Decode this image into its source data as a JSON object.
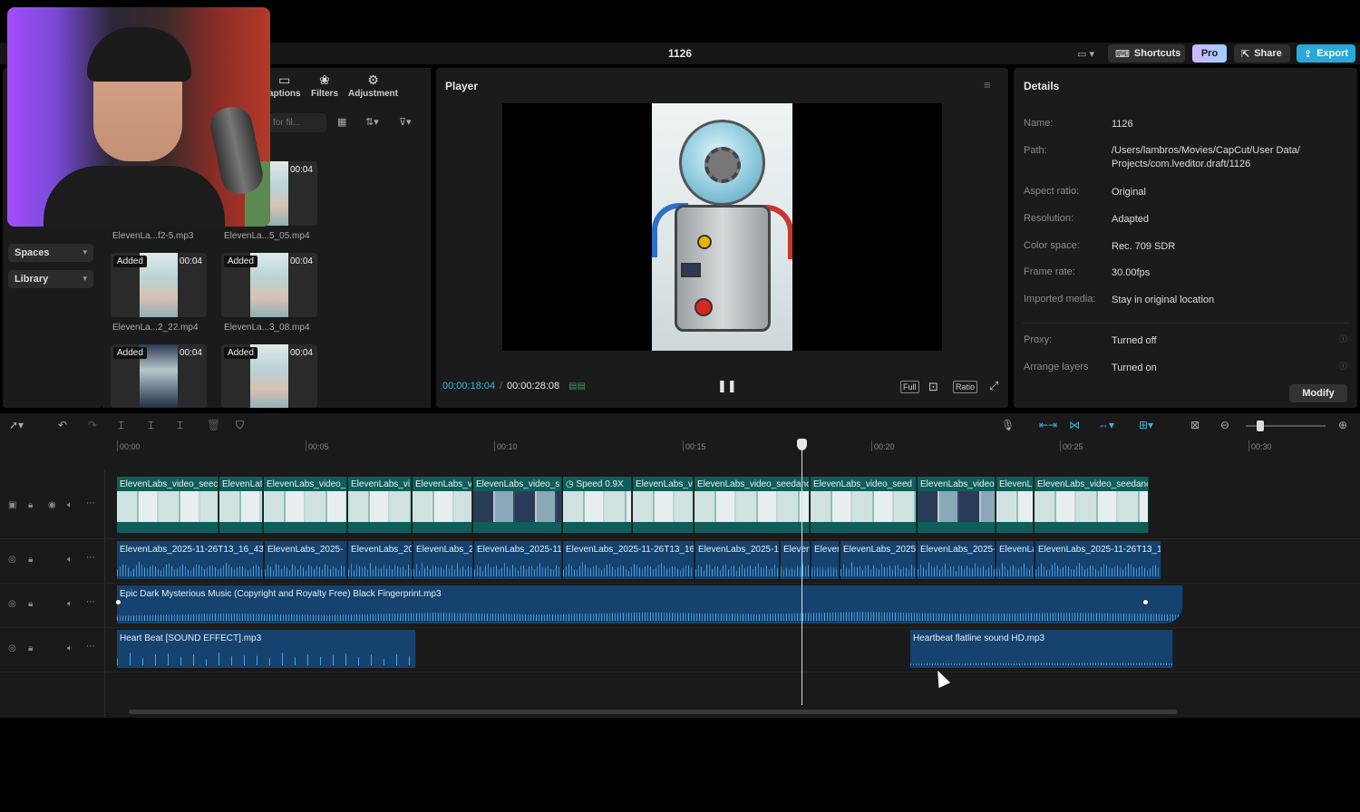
{
  "app": {
    "project_title": "1126",
    "shortcuts_label": "Shortcuts",
    "pro_label": "Pro",
    "share_label": "Share",
    "export_label": "Export"
  },
  "media_panel": {
    "tabs": [
      {
        "label": "aptions",
        "icon": "captions-icon"
      },
      {
        "label": "Filters",
        "icon": "filters-icon"
      },
      {
        "label": "Adjustment",
        "icon": "adjustment-icon"
      }
    ],
    "search_placeholder": "for fil...",
    "nav": {
      "spaces_label": "Spaces",
      "library_label": "Library"
    },
    "items": [
      {
        "name": "ElevenLa...f2-5.mp3",
        "badge": "",
        "duration": ""
      },
      {
        "name": "ElevenLa...5_05.mp4",
        "badge": "",
        "duration": "00:04"
      },
      {
        "name": "ElevenLa...2_22.mp4",
        "badge": "Added",
        "duration": "00:04"
      },
      {
        "name": "ElevenLa...3_08.mp4",
        "badge": "Added",
        "duration": "00:04"
      },
      {
        "name": "",
        "badge": "Added",
        "duration": "00:04"
      },
      {
        "name": "",
        "badge": "Added",
        "duration": "00:04"
      }
    ]
  },
  "player": {
    "title": "Player",
    "current_time": "00:00:18:04",
    "separator": "/",
    "total_time": "00:00:28:08",
    "full_label": "Full",
    "ratio_label": "Ratio"
  },
  "details": {
    "title": "Details",
    "fields": [
      {
        "label": "Name:",
        "value": "1126"
      },
      {
        "label": "Path:",
        "value": "/Users/lambros/Movies/CapCut/User Data/\nProjects/com.lveditor.draft/1126"
      },
      {
        "label": "Aspect ratio:",
        "value": "Original"
      },
      {
        "label": "Resolution:",
        "value": "Adapted"
      },
      {
        "label": "Color space:",
        "value": "Rec. 709 SDR"
      },
      {
        "label": "Frame rate:",
        "value": "30.00fps"
      },
      {
        "label": "Imported media:",
        "value": "Stay in original location"
      },
      {
        "label": "Proxy:",
        "value": "Turned off"
      },
      {
        "label": "Arrange layers",
        "value": "Turned on"
      }
    ],
    "modify_label": "Modify"
  },
  "timeline": {
    "ruler": [
      "00:00",
      "00:05",
      "00:10",
      "00:15",
      "00:20",
      "00:25",
      "00:30"
    ],
    "video_clips": [
      "ElevenLabs_video_seec",
      "ElevenLat",
      "ElevenLabs_video_",
      "ElevenLabs_vi",
      "ElevenLabs_v",
      "ElevenLabs_video_s",
      "Speed 0.9X",
      "ElevenLabs_vi",
      "ElevenLabs_video_seedanc",
      "ElevenLabs_video_seed",
      "ElevenLabs_video",
      "ElevenL",
      "ElevenLabs_video_seedanc"
    ],
    "voice_clips": [
      "ElevenLabs_2025-11-26T13_16_43",
      "ElevenLabs_2025-",
      "ElevenLabs_20",
      "ElevenLabs_2",
      "ElevenLabs_2025-11",
      "ElevenLabs_2025-11-26T13_16",
      "ElevenLabs_2025-1",
      "Eleven",
      "Elever",
      "ElevenLabs_2025",
      "ElevenLabs_2025-",
      "ElevenLa",
      "ElevenLabs_2025-11-26T13_1"
    ],
    "music_clip": "Epic Dark Mysterious Music (Copyright and Royalty Free) Black Fingerprint.mp3",
    "sfx_clips": [
      "Heart Beat [SOUND EFFECT].mp3",
      "Heartbeat flatline sound HD.mp3"
    ]
  }
}
